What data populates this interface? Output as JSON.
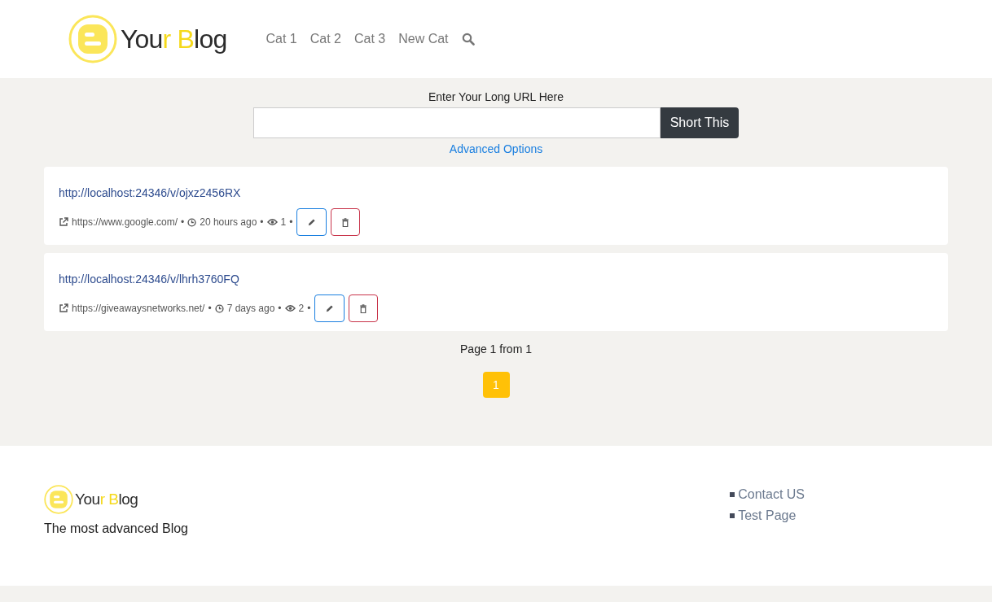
{
  "header": {
    "logo": [
      {
        "text": "You",
        "highlight": false
      },
      {
        "text": "r ",
        "highlight": true
      },
      {
        "text": "B",
        "highlight": true
      },
      {
        "text": "log",
        "highlight": false
      }
    ],
    "nav": [
      "Cat 1",
      "Cat 2",
      "Cat 3",
      "New Cat"
    ]
  },
  "shortener": {
    "label": "Enter Your Long URL Here",
    "button": "Short This",
    "advanced": "Advanced Options"
  },
  "links": [
    {
      "short_url": "http://localhost:24346/v/ojxz2456RX",
      "target": "https://www.google.com/",
      "time": "20 hours ago",
      "views": "1",
      "separators": [
        "•",
        "•",
        "•"
      ]
    },
    {
      "short_url": "http://localhost:24346/v/lhrh3760FQ",
      "target": "https://giveawaysnetworks.net/",
      "time": "7 days ago",
      "views": "2",
      "separators": [
        "•",
        "•",
        "•"
      ]
    }
  ],
  "pagination": {
    "summary": "Page 1 from 1",
    "pages": [
      {
        "label": "1",
        "selected": true
      }
    ]
  },
  "footer": {
    "logo": [
      {
        "text": "You",
        "highlight": false
      },
      {
        "text": "r ",
        "highlight": true
      },
      {
        "text": "B",
        "highlight": true
      },
      {
        "text": "log",
        "highlight": false
      }
    ],
    "tagline": "The most advanced Blog",
    "links": [
      "Contact US",
      "Test Page"
    ]
  }
}
